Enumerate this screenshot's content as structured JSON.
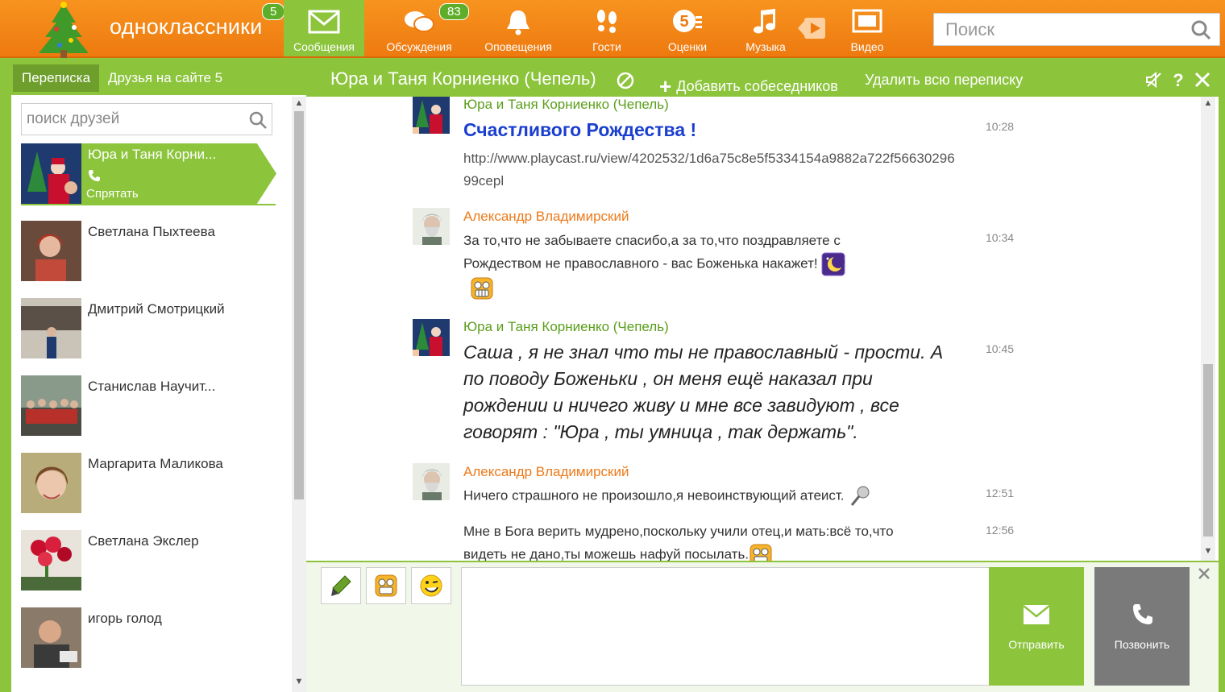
{
  "brand": {
    "name": "одноклассники",
    "badge": "5",
    "colors": {
      "orange": "#f7931e",
      "green": "#8cc43c",
      "dark_green": "#6e9e2c"
    }
  },
  "nav": {
    "items": [
      {
        "label": "Сообщения",
        "icon": "envelope-icon",
        "active": true
      },
      {
        "label": "Обсуждения",
        "icon": "speech-bubbles-icon",
        "badge": "83"
      },
      {
        "label": "Оповещения",
        "icon": "bell-icon"
      },
      {
        "label": "Гости",
        "icon": "footprints-icon"
      },
      {
        "label": "Оценки",
        "icon": "rating-five-icon"
      },
      {
        "label": "Музыка",
        "icon": "music-note-icon"
      },
      {
        "label": "Видео",
        "icon": "video-icon"
      }
    ],
    "search_placeholder": "Поиск"
  },
  "left": {
    "tabs": [
      {
        "label": "Переписка",
        "active": true
      },
      {
        "label": "Друзья на сайте 5"
      }
    ],
    "search_placeholder": "поиск друзей",
    "friends": [
      {
        "name": "Юра и Таня Корни...",
        "active": true,
        "action": "Спрятать"
      },
      {
        "name": "Светлана Пыхтеева"
      },
      {
        "name": "Дмитрий Смотрицкий"
      },
      {
        "name": "Станислав Научит..."
      },
      {
        "name": "Маргарита Маликова"
      },
      {
        "name": "Светлана Экслер"
      },
      {
        "name": "игорь голод"
      }
    ]
  },
  "chat": {
    "title": "Юра и Таня Корниенко (Чепель)",
    "add_label": "Добавить собеседников",
    "delete_label": "Удалить всю переписку",
    "messages": [
      {
        "author": "Юра и Таня Корниенко (Чепель)",
        "time": "10:28",
        "title": "Счастливого Рождества !",
        "link": "http://www.playcast.ru/view/4202532/1d6a75c8e5f5334154a9882a722f5663029699cepl"
      },
      {
        "author": "Александр Владимирский",
        "time": "10:34",
        "text": " За то,что не забываете спасибо,а за то,что поздравляете с Рождеством не православного - вас Боженька накажет!"
      },
      {
        "author": "Юра и Таня Корниенко (Чепель)",
        "time": "10:45",
        "text": "Саша , я не знал что ты не православный - прости. А по поводу Боженьки , он меня ещё наказал при рождении и ничего живу и мне все завидуют , все говорят : \"Юра , ты умница , так держать\"."
      },
      {
        "author": "Александр Владимирский",
        "time": "12:51",
        "text": "Ничего страшного не произошло,я невоинствующий атеист."
      },
      {
        "time": "12:56",
        "text": "Мне в Бога верить мудрено,поскольку учили отец,и мать:всё то,что видеть не дано,ты можешь нафуй посылать."
      }
    ]
  },
  "composer": {
    "send_label": "Отправить",
    "call_label": "Позвонить",
    "input_value": ""
  }
}
